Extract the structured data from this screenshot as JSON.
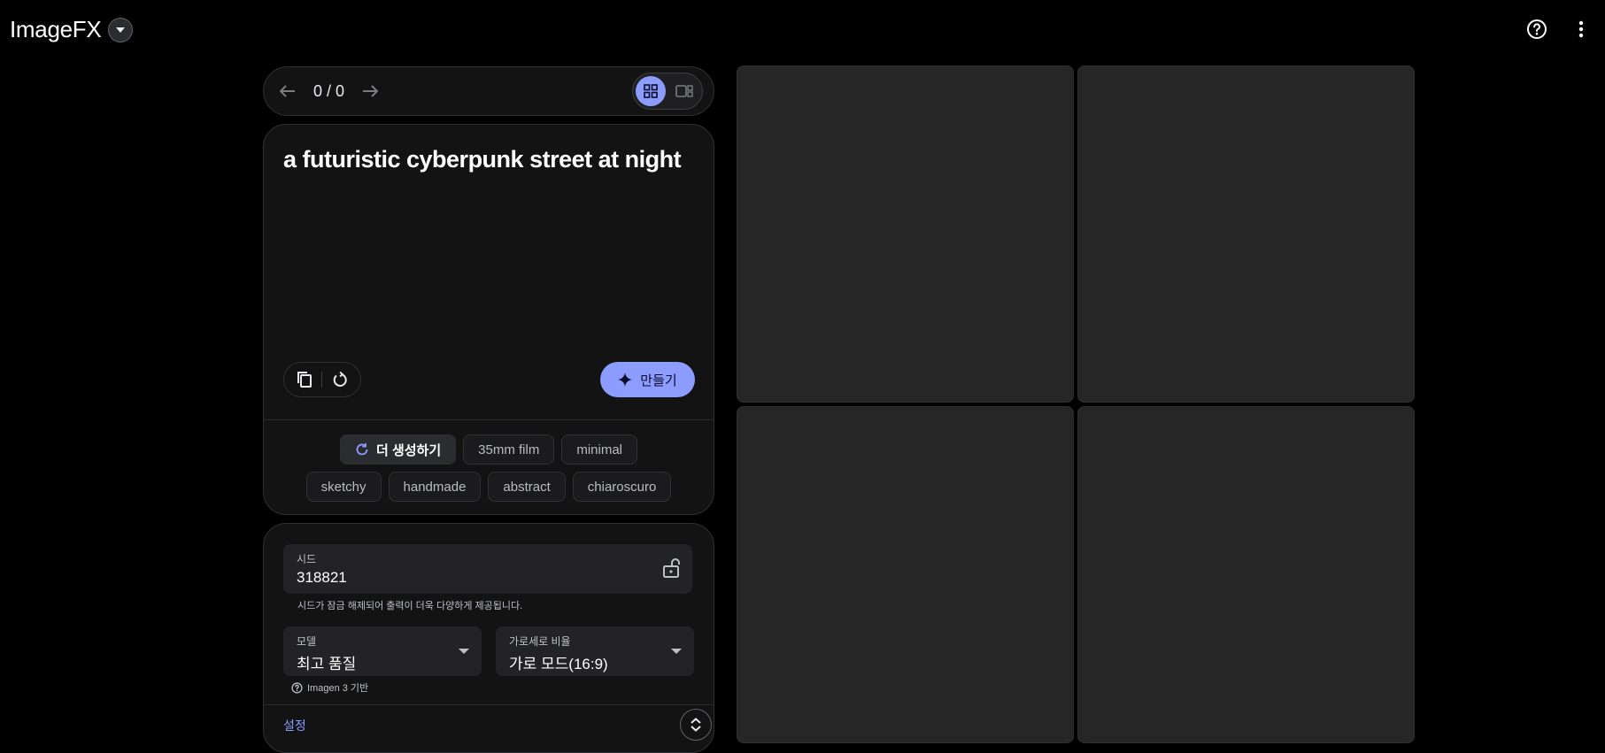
{
  "app": {
    "title": "ImageFX"
  },
  "topbar": {
    "help_icon": "help-circle-icon",
    "more_icon": "more-vert-icon"
  },
  "navigation": {
    "counter": "0 / 0"
  },
  "prompt": {
    "text": "a futuristic cyberpunk street at night"
  },
  "actions": {
    "create_label": "만들기"
  },
  "chips": {
    "primary_label": "더 생성하기",
    "items": [
      "35mm film",
      "minimal",
      "sketchy",
      "handmade",
      "abstract",
      "chiaroscuro"
    ]
  },
  "seed": {
    "label": "시드",
    "value": "318821",
    "note": "시드가 잠금 해제되어 출력이 더욱 다양하게 제공됩니다."
  },
  "model": {
    "label": "모델",
    "value": "최고 품질",
    "note": "Imagen 3 기반"
  },
  "aspect_ratio": {
    "label": "가로세로 비율",
    "value": "가로 모드(16:9)"
  },
  "settings": {
    "label": "설정"
  },
  "colors": {
    "accent": "#8c9cff",
    "background": "#000000",
    "card": "#131314",
    "tile": "#262626"
  }
}
